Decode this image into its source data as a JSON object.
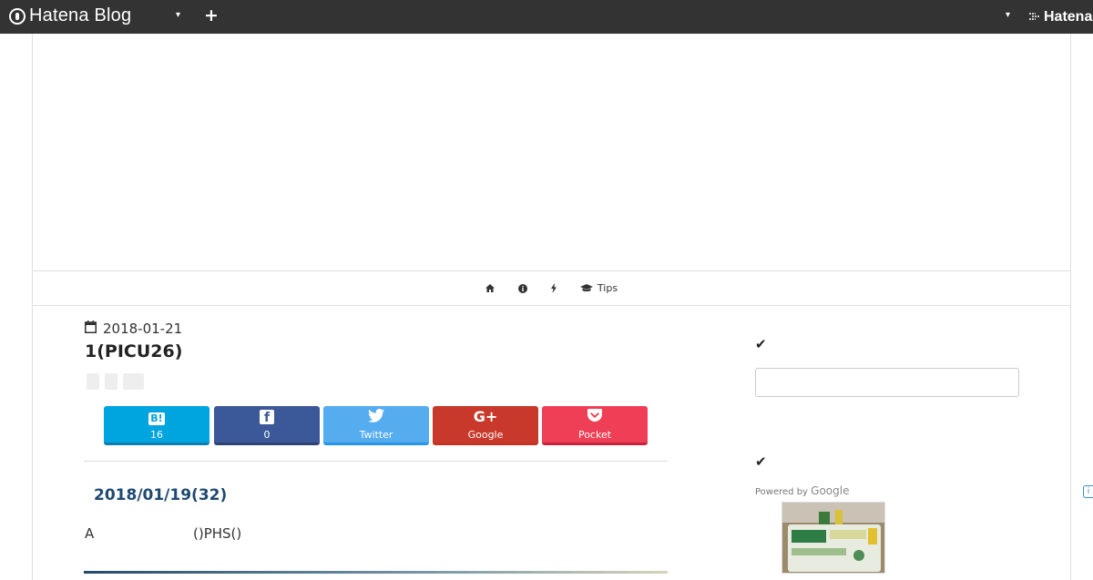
{
  "topbar": {
    "logo_text": "Hatena Blog",
    "menu_caret": "▾",
    "add_label": "+",
    "account_caret": "▾",
    "hatena_brand": "Hatena"
  },
  "nav": {
    "items": [
      {
        "icon": "home-icon",
        "label": ""
      },
      {
        "icon": "info-icon",
        "label": ""
      },
      {
        "icon": "bolt-icon",
        "label": ""
      },
      {
        "icon": "graduation-cap-icon",
        "label": "Tips"
      }
    ]
  },
  "article": {
    "date": "2018-01-21",
    "title": "1(PICU26)",
    "share": {
      "hatena_glyph": "B!",
      "hatena_count": "16",
      "facebook_glyph": "f",
      "facebook_count": "0",
      "twitter_label": "Twitter",
      "google_glyph": "G+",
      "google_label": "Google",
      "pocket_label": "Pocket"
    },
    "subheading": "2018/01/19(32)",
    "paragraph_a": "A",
    "paragraph_b": "()PHS()"
  },
  "sidebar": {
    "check_glyph_1": "✔",
    "check_glyph_2": "✔",
    "search_value": "",
    "powered_by": "Powered by",
    "powered_brand": "Google"
  },
  "colors": {
    "topbar": "#333333",
    "hatena": "#00a4de",
    "facebook": "#3b5998",
    "twitter": "#55acee",
    "google": "#c9392b",
    "pocket": "#ef3f56",
    "subheading": "#1e4a72"
  }
}
